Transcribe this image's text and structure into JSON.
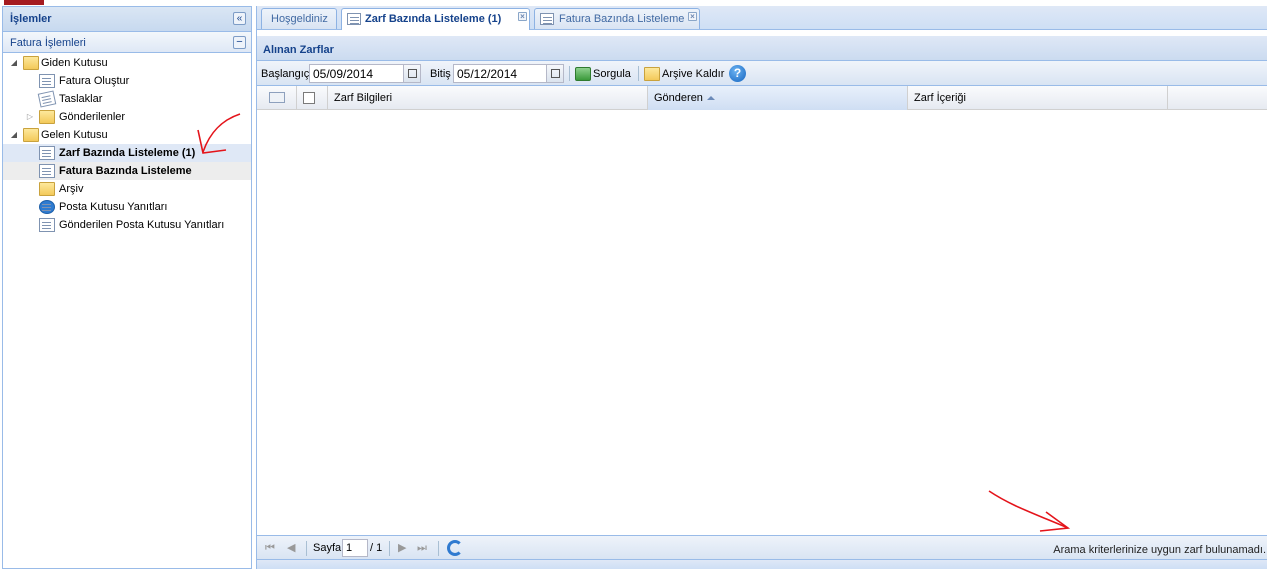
{
  "west": {
    "title": "İşlemler",
    "section": "Fatura İşlemleri",
    "tree": [
      {
        "label": "Giden Kutusu",
        "level": 0,
        "icon": "folder-icon",
        "expanded": true
      },
      {
        "label": "Fatura Oluştur",
        "level": 1,
        "icon": "invoice-create-icon"
      },
      {
        "label": "Taslaklar",
        "level": 1,
        "icon": "drafts-icon"
      },
      {
        "label": "Gönderilenler",
        "level": 1,
        "icon": "sent-icon",
        "expandable": true
      },
      {
        "label": "Gelen Kutusu",
        "level": 0,
        "icon": "folder-icon",
        "expanded": true
      },
      {
        "label": "Zarf Bazında Listeleme (1)",
        "level": 1,
        "icon": "envelope-list-icon",
        "selected": true
      },
      {
        "label": "Fatura Bazında Listeleme",
        "level": 1,
        "icon": "invoice-list-icon",
        "bold": true
      },
      {
        "label": "Arşiv",
        "level": 1,
        "icon": "archive-icon"
      },
      {
        "label": "Posta Kutusu Yanıtları",
        "level": 1,
        "icon": "mailbox-reply-icon"
      },
      {
        "label": "Gönderilen Posta Kutusu Yanıtları",
        "level": 1,
        "icon": "sent-mailbox-reply-icon"
      }
    ]
  },
  "tabs": [
    {
      "label": "Hoşgeldiniz",
      "active": false,
      "closable": false
    },
    {
      "label": "Zarf Bazında Listeleme (1)",
      "active": true,
      "closable": true
    },
    {
      "label": "Fatura Bazında Listeleme",
      "active": false,
      "closable": true
    }
  ],
  "panel": {
    "title": "Alınan Zarflar"
  },
  "toolbar": {
    "start_label": "Başlangıç",
    "start_value": "05/09/2014",
    "end_label": "Bitiş",
    "end_value": "05/12/2014",
    "query_label": "Sorgula",
    "archive_remove_label": "Arşive Kaldır",
    "help_label": "?"
  },
  "grid": {
    "columns": [
      "Zarf Bilgileri",
      "Gönderen",
      "Zarf İçeriği"
    ],
    "sorted_column": "Gönderen"
  },
  "paging": {
    "page_label": "Sayfa",
    "page_value": "1",
    "page_total": "/ 1",
    "status": "Arama kriterlerinize uygun zarf bulunamadı."
  },
  "colors": {
    "accent": "#15428b",
    "border": "#99bbe8",
    "annotation": "#e4141b"
  }
}
